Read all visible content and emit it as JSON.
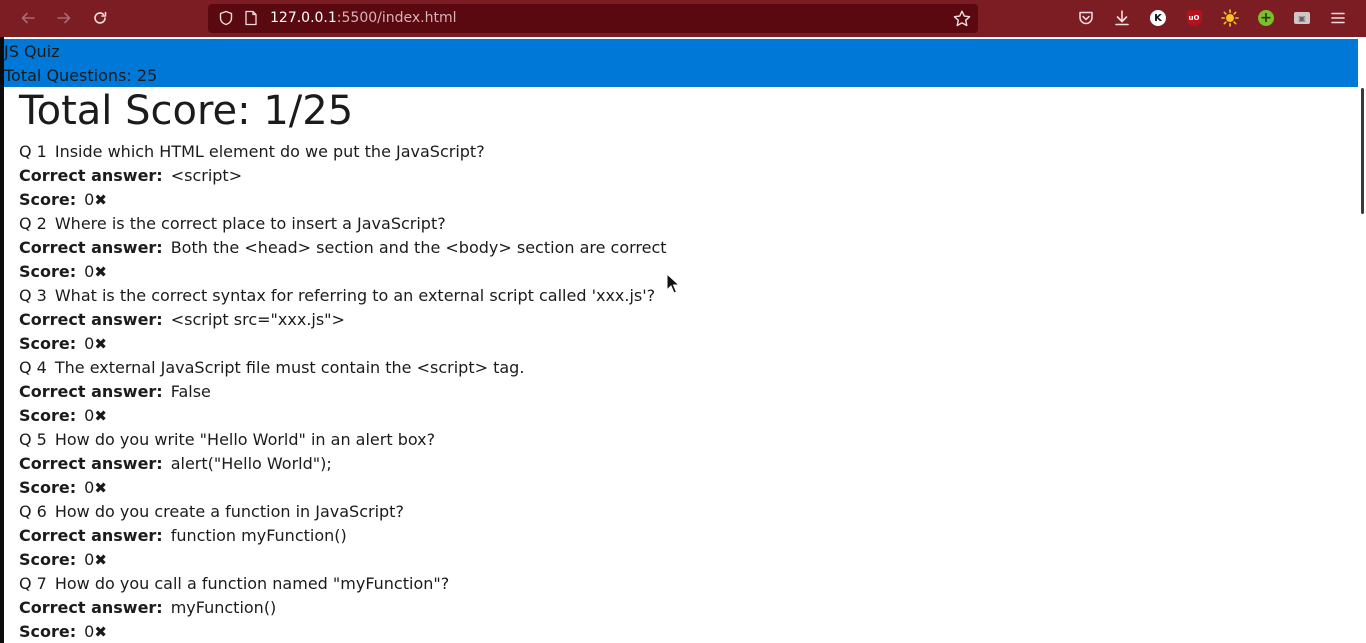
{
  "browser": {
    "url_host": "127.0.0.1",
    "url_rest": ":5500/index.html",
    "account_initial": "K",
    "ublock_label": "uO",
    "colors": {
      "toolbar": "#7c1d24",
      "urlbar": "#5a0910"
    },
    "icons": [
      "back-arrow-icon",
      "forward-arrow-icon",
      "reload-icon",
      "shield-icon",
      "page-icon",
      "bookmark-star-icon",
      "pocket-icon",
      "download-icon",
      "account-icon",
      "ublock-icon",
      "dark-reader-icon",
      "green-addon-icon",
      "gray-addon-icon",
      "hamburger-menu-icon"
    ]
  },
  "header": {
    "title": "JS Quiz",
    "total_questions": "Total Questions: 25",
    "color": "#0078d7"
  },
  "summary": {
    "total_score": "Total Score:  1/25"
  },
  "labels": {
    "correct_answer": "Correct answer:",
    "score": "Score:",
    "wrong_mark": "✖"
  },
  "questions": [
    {
      "num": "Q 1",
      "text": "Inside which HTML element do we put the JavaScript?",
      "answer": "<script>",
      "score": "0"
    },
    {
      "num": "Q 2",
      "text": "Where is the correct place to insert a JavaScript?",
      "answer": "Both the <head> section and the <body> section are correct",
      "score": "0"
    },
    {
      "num": "Q 3",
      "text": "What is the correct syntax for referring to an external script called 'xxx.js'?",
      "answer": "<script src=\"xxx.js\">",
      "score": "0"
    },
    {
      "num": "Q 4",
      "text": "The external JavaScript file must contain the <script> tag.",
      "answer": "False",
      "score": "0"
    },
    {
      "num": "Q 5",
      "text": "How do you write \"Hello World\" in an alert box?",
      "answer": "alert(\"Hello World\");",
      "score": "0"
    },
    {
      "num": "Q 6",
      "text": "How do you create a function in JavaScript?",
      "answer": "function myFunction()",
      "score": "0"
    },
    {
      "num": "Q 7",
      "text": "How do you call a function named \"myFunction\"?",
      "answer": "myFunction()",
      "score": "0"
    }
  ]
}
